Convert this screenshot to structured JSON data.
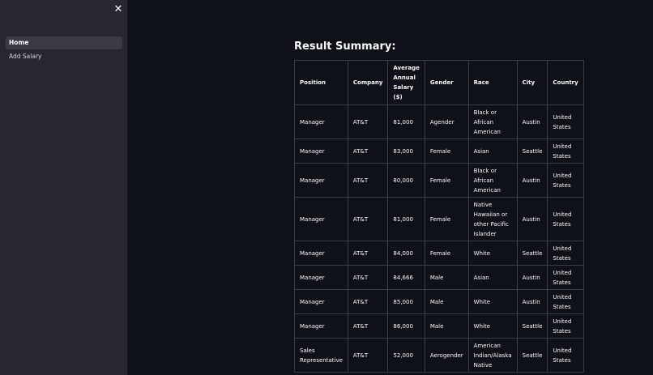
{
  "sidebar": {
    "close_label": "✕",
    "items": [
      {
        "label": "Home",
        "active": true
      },
      {
        "label": "Add Salary",
        "active": false
      }
    ]
  },
  "main": {
    "title": "Result Summary:",
    "table": {
      "headers": [
        "Position",
        "Company",
        "Average Annual Salary ($)",
        "Gender",
        "Race",
        "City",
        "Country"
      ],
      "rows": [
        [
          "Manager",
          "AT&T",
          "81,000",
          "Agender",
          "Black or African American",
          "Austin",
          "United States"
        ],
        [
          "Manager",
          "AT&T",
          "83,000",
          "Female",
          "Asian",
          "Seattle",
          "United States"
        ],
        [
          "Manager",
          "AT&T",
          "80,000",
          "Female",
          "Black or African American",
          "Austin",
          "United States"
        ],
        [
          "Manager",
          "AT&T",
          "81,000",
          "Female",
          "Native Hawaiian or other Pacific Islander",
          "Austin",
          "United States"
        ],
        [
          "Manager",
          "AT&T",
          "84,000",
          "Female",
          "White",
          "Seattle",
          "United States"
        ],
        [
          "Manager",
          "AT&T",
          "84,666",
          "Male",
          "Asian",
          "Austin",
          "United States"
        ],
        [
          "Manager",
          "AT&T",
          "85,000",
          "Male",
          "White",
          "Austin",
          "United States"
        ],
        [
          "Manager",
          "AT&T",
          "86,000",
          "Male",
          "White",
          "Seattle",
          "United States"
        ],
        [
          "Sales Representative",
          "AT&T",
          "52,000",
          "Aerogender",
          "American Indian/Alaska Native",
          "Seattle",
          "United States"
        ]
      ]
    }
  },
  "colors": {
    "background": "#0e1117",
    "sidebar": "#262730",
    "text": "#fafafa",
    "border": "#3b3d45"
  }
}
